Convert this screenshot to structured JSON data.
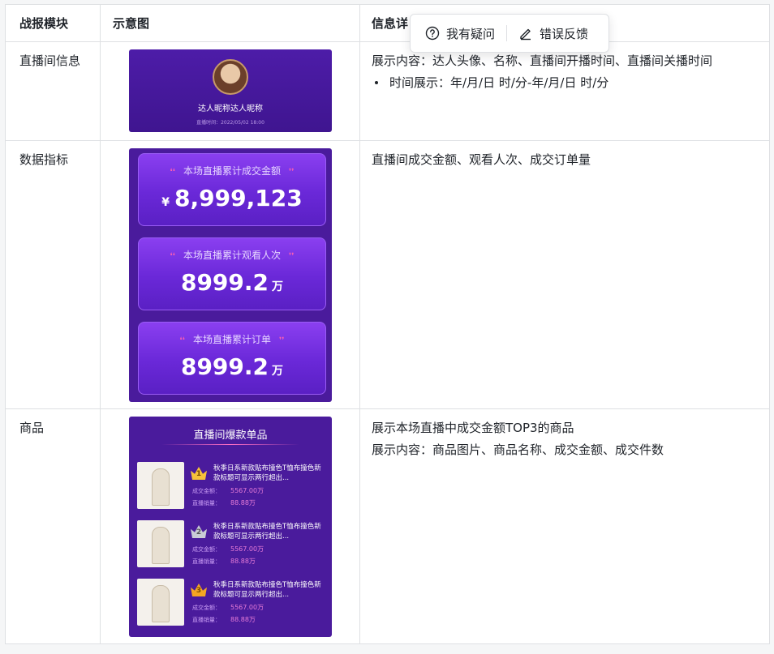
{
  "table": {
    "headers": [
      "战报模块",
      "示意图",
      "信息详"
    ],
    "rows": [
      {
        "module": "直播间信息",
        "preview": {
          "name": "达人昵称达人昵称",
          "time": "直播时间：2022/05/02 18:00"
        },
        "detail_line1": "展示内容：达人头像、名称、直播间开播时间、直播间关播时间",
        "detail_bullet": "时间展示：年/月/日 时/分-年/月/日 时/分"
      },
      {
        "module": "数据指标",
        "preview": {
          "cards": [
            {
              "label": "本场直播累计成交金额",
              "prefix": "¥",
              "value": "8,999,123",
              "unit": ""
            },
            {
              "label": "本场直播累计观看人次",
              "prefix": "",
              "value": "8999.2",
              "unit": "万"
            },
            {
              "label": "本场直播累计订单",
              "prefix": "",
              "value": "8999.2",
              "unit": "万"
            }
          ]
        },
        "detail_line1": "直播间成交金额、观看人次、成交订单量"
      },
      {
        "module": "商品",
        "preview": {
          "title": "直播间爆款单品",
          "products": [
            {
              "rank": "1",
              "name": "秋季日系新款贴布撞色T恤布撞色新款标题可显示两行超出...",
              "sales_label": "成交金额：",
              "sales_value": "5567.00万",
              "volume_label": "直播销量：",
              "volume_value": "88.88万"
            },
            {
              "rank": "2",
              "name": "秋季日系新款贴布撞色T恤布撞色新款标题可显示两行超出...",
              "sales_label": "成交金额：",
              "sales_value": "5567.00万",
              "volume_label": "直播销量：",
              "volume_value": "88.88万"
            },
            {
              "rank": "3",
              "name": "秋季日系新款贴布撞色T恤布撞色新款标题可显示两行超出...",
              "sales_label": "成交金额：",
              "sales_value": "5567.00万",
              "volume_label": "直播销量：",
              "volume_value": "88.88万"
            }
          ]
        },
        "detail_line1": "展示本场直播中成交金额TOP3的商品",
        "detail_line2": "展示内容：商品图片、商品名称、成交金额、成交件数"
      }
    ]
  },
  "popup": {
    "question_label": "我有疑问",
    "question_icon": "question-circle-icon",
    "feedback_label": "错误反馈",
    "feedback_icon": "pencil-icon"
  },
  "colors": {
    "preview_bg": "#4a1b9c",
    "card_gradient_top": "#8a3ff0",
    "accent_pink": "#ff5fb0",
    "border": "#dee0e3"
  }
}
